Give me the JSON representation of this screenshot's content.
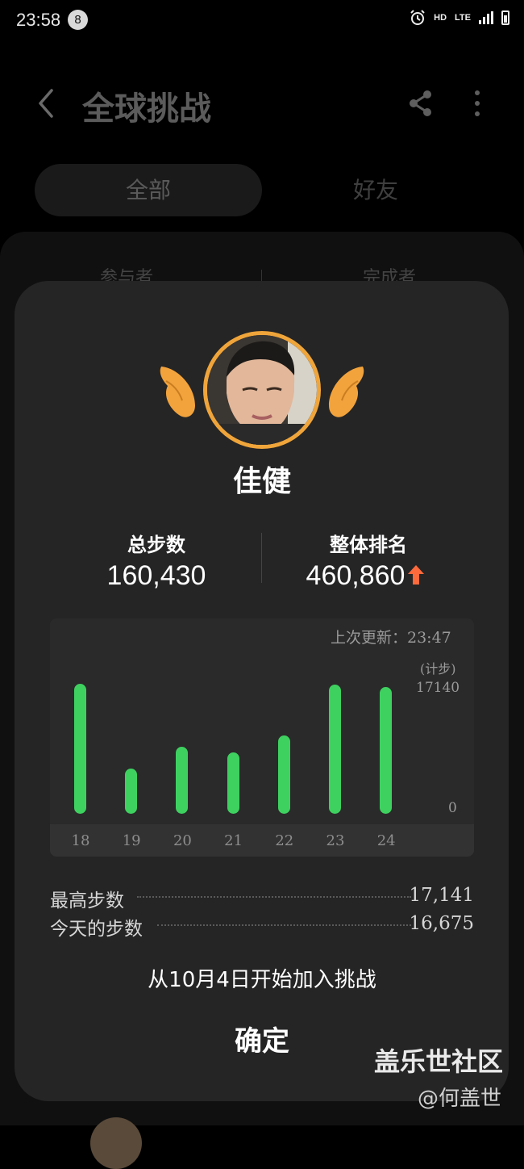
{
  "status_bar": {
    "time": "23:58",
    "notification_count": "8",
    "hd": "HD",
    "lte": "LTE"
  },
  "header": {
    "title": "全球挑战",
    "back_icon": "chevron-left-icon",
    "share_icon": "share-icon",
    "more_icon": "more-vertical-icon"
  },
  "tabs": [
    {
      "label": "全部",
      "selected": true
    },
    {
      "label": "好友",
      "selected": false
    }
  ],
  "background_card": {
    "col1": "参与者",
    "col2": "完成者"
  },
  "profile": {
    "name": "佳健",
    "total_steps_label": "总步数",
    "total_steps": "160,430",
    "rank_label": "整体排名",
    "rank": "460,860",
    "rank_trend": "up",
    "accent_color": "#f0a53a",
    "trend_color": "#ff6a3d"
  },
  "chart_data": {
    "type": "bar",
    "updated": "上次更新：23:47",
    "unit": "(计步)",
    "categories": [
      "18",
      "19",
      "20",
      "21",
      "22",
      "23",
      "24"
    ],
    "values": [
      16800,
      5900,
      8700,
      7900,
      10100,
      16700,
      16400
    ],
    "ylim": [
      0,
      17140
    ],
    "ymax_label": "17140",
    "ymin_label": "0",
    "bar_color": "#3ed160"
  },
  "summary": [
    {
      "label": "最高步数",
      "value": "17,141"
    },
    {
      "label": "今天的步数",
      "value": "16,675"
    }
  ],
  "joined_text": "从10月4日开始加入挑战",
  "confirm_label": "确定",
  "watermark": {
    "main": "盖乐世社区",
    "sub": "@何盖世"
  }
}
